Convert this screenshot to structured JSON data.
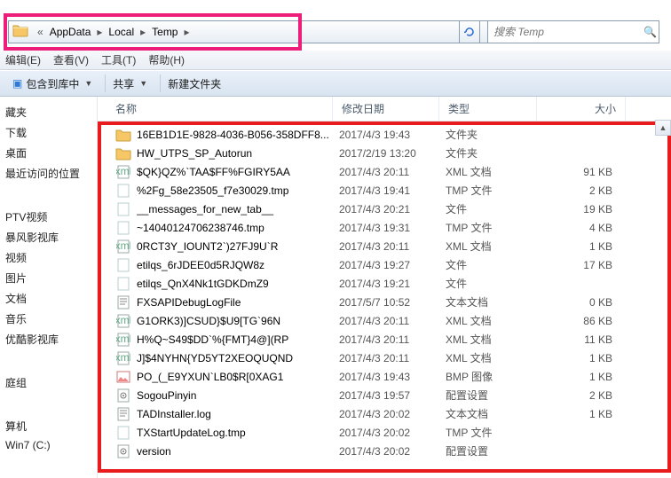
{
  "breadcrumb": {
    "prefix": "«",
    "segments": [
      "AppData",
      "Local",
      "Temp"
    ]
  },
  "search": {
    "placeholder": "搜索 Temp"
  },
  "menubar": [
    "编辑(E)",
    "查看(V)",
    "工具(T)",
    "帮助(H)"
  ],
  "toolbar": {
    "organize": "包含到库中",
    "share": "共享",
    "newfolder": "新建文件夹"
  },
  "sidebar": {
    "fav": [
      "藏夹",
      "下载",
      "桌面",
      "最近访问的位置"
    ],
    "libs": [
      "PTV视频",
      "暴风影视库",
      "视频",
      "图片",
      "文档",
      "音乐",
      "优酷影视库"
    ],
    "groups": [
      "庭组"
    ],
    "computer": [
      "算机",
      "Win7 (C:)"
    ]
  },
  "columns": {
    "name": "名称",
    "date": "修改日期",
    "type": "类型",
    "size": "大小"
  },
  "files": [
    {
      "icon": "folder",
      "name": "16EB1D1E-9828-4036-B056-358DFF8...",
      "date": "2017/4/3 19:43",
      "type": "文件夹",
      "size": ""
    },
    {
      "icon": "folder",
      "name": "HW_UTPS_SP_Autorun",
      "date": "2017/2/19 13:20",
      "type": "文件夹",
      "size": ""
    },
    {
      "icon": "xml",
      "name": "$QK}QZ%`TAA$FF%FGIRY5AA",
      "date": "2017/4/3 20:11",
      "type": "XML 文档",
      "size": "91 KB"
    },
    {
      "icon": "file",
      "name": "%2Fg_58e23505_f7e30029.tmp",
      "date": "2017/4/3 19:41",
      "type": "TMP 文件",
      "size": "2 KB"
    },
    {
      "icon": "file",
      "name": "__messages_for_new_tab__",
      "date": "2017/4/3 20:21",
      "type": "文件",
      "size": "19 KB"
    },
    {
      "icon": "file",
      "name": "~14040124706238746.tmp",
      "date": "2017/4/3 19:31",
      "type": "TMP 文件",
      "size": "4 KB"
    },
    {
      "icon": "xml",
      "name": "0RCT3Y_IOUNT2`)27FJ9U`R",
      "date": "2017/4/3 20:11",
      "type": "XML 文档",
      "size": "1 KB"
    },
    {
      "icon": "file",
      "name": "etilqs_6rJDEE0d5RJQW8z",
      "date": "2017/4/3 19:27",
      "type": "文件",
      "size": "17 KB"
    },
    {
      "icon": "file",
      "name": "etilqs_QnX4Nk1tGDKDmZ9",
      "date": "2017/4/3 19:21",
      "type": "文件",
      "size": ""
    },
    {
      "icon": "txt",
      "name": "FXSAPIDebugLogFile",
      "date": "2017/5/7 10:52",
      "type": "文本文档",
      "size": "0 KB"
    },
    {
      "icon": "xml",
      "name": "G1ORK3)]CSUD}$U9[TG`96N",
      "date": "2017/4/3 20:11",
      "type": "XML 文档",
      "size": "86 KB"
    },
    {
      "icon": "xml",
      "name": "H%Q~S49$DD`%{FMT}4@](RP",
      "date": "2017/4/3 20:11",
      "type": "XML 文档",
      "size": "11 KB"
    },
    {
      "icon": "xml",
      "name": "J]$4NYHN{YD5YT2XEOQUQND",
      "date": "2017/4/3 20:11",
      "type": "XML 文档",
      "size": "1 KB"
    },
    {
      "icon": "bmp",
      "name": "PO_(_E9YXUN`LB0$R[0XAG1",
      "date": "2017/4/3 19:43",
      "type": "BMP 图像",
      "size": "1 KB"
    },
    {
      "icon": "cfg",
      "name": "SogouPinyin",
      "date": "2017/4/3 19:57",
      "type": "配置设置",
      "size": "2 KB"
    },
    {
      "icon": "txt",
      "name": "TADInstaller.log",
      "date": "2017/4/3 20:02",
      "type": "文本文档",
      "size": "1 KB"
    },
    {
      "icon": "file",
      "name": "TXStartUpdateLog.tmp",
      "date": "2017/4/3 20:02",
      "type": "TMP 文件",
      "size": ""
    },
    {
      "icon": "cfg",
      "name": "version",
      "date": "2017/4/3 20:02",
      "type": "配置设置",
      "size": ""
    }
  ]
}
